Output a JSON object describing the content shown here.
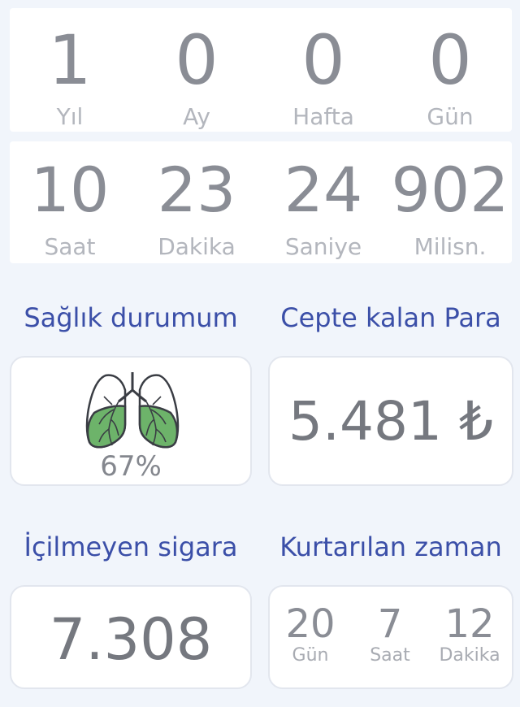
{
  "elapsed_top": [
    {
      "value": "1",
      "unit": "Yıl"
    },
    {
      "value": "0",
      "unit": "Ay"
    },
    {
      "value": "0",
      "unit": "Hafta"
    },
    {
      "value": "0",
      "unit": "Gün"
    }
  ],
  "elapsed_bottom": [
    {
      "value": "10",
      "unit": "Saat"
    },
    {
      "value": "23",
      "unit": "Dakika"
    },
    {
      "value": "24",
      "unit": "Saniye"
    },
    {
      "value": "902",
      "unit": "Milisn."
    }
  ],
  "health": {
    "title": "Sağlık durumum",
    "percent_text": "67%",
    "percent_value": 0.67,
    "icon": "lungs-icon",
    "lung_color": "#6db36a"
  },
  "money": {
    "title": "Cepte kalan Para",
    "value": "5.481 ₺"
  },
  "cigarettes": {
    "title": "İçilmeyen sigara",
    "value": "7.308"
  },
  "time_saved": {
    "title": "Kurtarılan zaman",
    "items": [
      {
        "value": "20",
        "unit": "Gün"
      },
      {
        "value": "7",
        "unit": "Saat"
      },
      {
        "value": "12",
        "unit": "Dakika"
      }
    ]
  },
  "colors": {
    "accent": "#3b4fa8",
    "background": "#f1f5fb"
  }
}
